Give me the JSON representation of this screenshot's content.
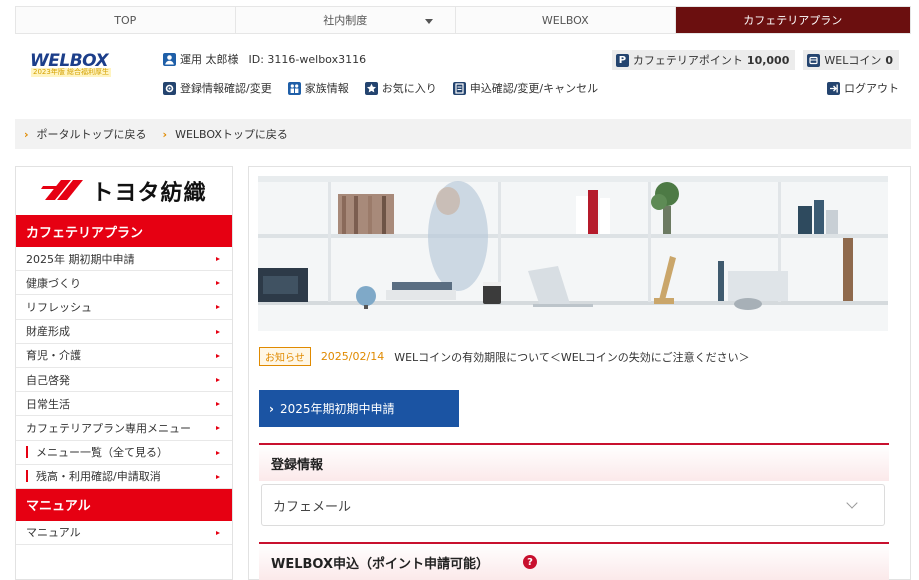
{
  "topnav": {
    "tabs": [
      {
        "label": "TOP"
      },
      {
        "label": "社内制度"
      },
      {
        "label": "WELBOX"
      },
      {
        "label": "カフェテリアプラン"
      }
    ]
  },
  "header": {
    "logo_text": "WELBOX",
    "logo_sub": "2023年版 総合福利厚生",
    "user_name": "運用 太郎様",
    "user_id": "ID: 3116-welbox3116",
    "links": [
      {
        "label": "登録情報確認/変更"
      },
      {
        "label": "家族情報"
      },
      {
        "label": "お気に入り"
      },
      {
        "label": "申込確認/変更/キャンセル"
      }
    ],
    "cafeteria_points_label": "カフェテリアポイント",
    "cafeteria_points_value": "10,000",
    "welcoin_label": "WELコイン",
    "welcoin_value": "0",
    "logout_label": "ログアウト"
  },
  "breadcrumb": [
    {
      "label": "ポータルトップに戻る"
    },
    {
      "label": "WELBOXトップに戻る"
    }
  ],
  "sidebar": {
    "company_name": "トヨタ紡織",
    "section1_title": "カフェテリアプラン",
    "items": [
      {
        "label": "2025年 期初期中申請"
      },
      {
        "label": "健康づくり"
      },
      {
        "label": "リフレッシュ"
      },
      {
        "label": "財産形成"
      },
      {
        "label": "育児・介護"
      },
      {
        "label": "自己啓発"
      },
      {
        "label": "日常生活"
      },
      {
        "label": "カフェテリアプラン専用メニュー"
      },
      {
        "label": "メニュー一覧（全て見る）"
      },
      {
        "label": "残高・利用確認/申請取消"
      }
    ],
    "section2_title": "マニュアル",
    "items2": [
      {
        "label": "マニュアル"
      }
    ]
  },
  "main": {
    "news_tag": "お知らせ",
    "news_date": "2025/02/14",
    "news_text": "WELコインの有効期限について＜WELコインの失効にご注意ください＞",
    "apply_button": "2025年期初期中申請",
    "section_registration": "登録情報",
    "cafe_mail": "カフェメール",
    "section_welbox": "WELBOX申込（ポイント申請可能）",
    "help_icon_glyph": "?"
  }
}
